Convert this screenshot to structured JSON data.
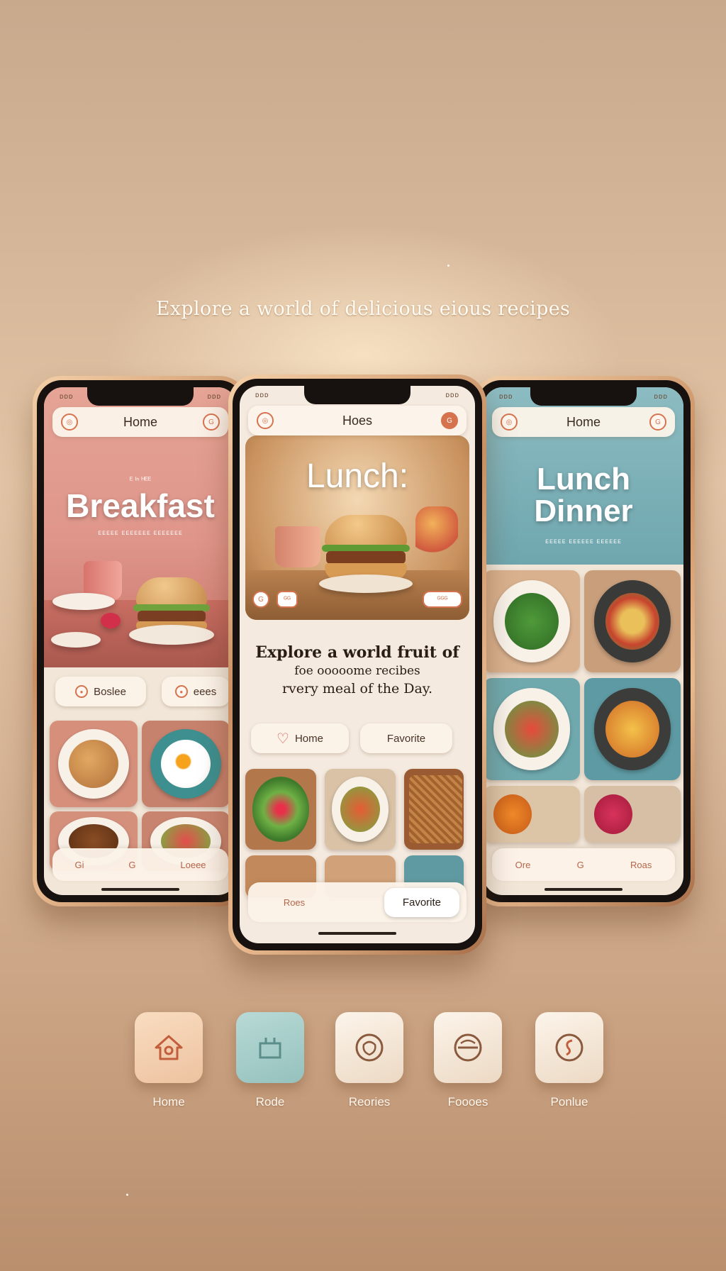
{
  "tagline": "Explore a world of delicious eious recipes",
  "phones": {
    "left": {
      "status_left": "ᴅᴅᴅ",
      "status_right": "ᴅᴅᴅ",
      "header_title": "Home",
      "hero_small": "ᴱ ᴵⁿ ᴴᴱᴱ",
      "hero_title": "Breakfast",
      "hero_sub": "ᴇᴇᴇᴇᴇ ᴇᴇᴇᴇᴇᴇᴇ ᴇᴇᴇᴇᴇᴇᴇ",
      "pill_left": "Boslee",
      "pill_right": "eees",
      "bottom_items": [
        "Gi",
        "G",
        "Loeee"
      ]
    },
    "center": {
      "status_left": "ᴅᴅᴅ",
      "status_right": "ᴅᴅᴅ",
      "header_title": "Hoes",
      "hero_title": "Lunch:",
      "hero_badges": [
        "G",
        "ᴳᴳ",
        "ᴳᴳᴳ"
      ],
      "headline_lines": [
        "Explore a world fruit of",
        "foe ooooome recibes",
        "rvery meal of the Day."
      ],
      "pill_home": "Home",
      "pill_favorite": "Favorite",
      "bottom_left": "Roes",
      "bottom_right": "Favorite"
    },
    "right": {
      "status_left": "ᴅᴅᴅ",
      "status_right": "ᴅᴅᴅ",
      "header_title": "Home",
      "hero_title_1": "Lunch",
      "hero_title_2": "Dinner",
      "hero_sub": "ᴇᴇᴇᴇᴇ ᴇᴇᴇᴇᴇᴇ ᴇᴇᴇᴇᴇᴇ",
      "bottom_items": [
        "Ore",
        "G",
        "Roas"
      ]
    }
  },
  "icon_row": [
    {
      "label": "Home",
      "icon": "home-icon"
    },
    {
      "label": "Rode",
      "icon": "shop-icon"
    },
    {
      "label": "Reories",
      "icon": "recipes-icon"
    },
    {
      "label": "Foooes",
      "icon": "plate-icon"
    },
    {
      "label": "Ponlue",
      "icon": "profile-icon"
    }
  ],
  "colors": {
    "background": "#d8b89a",
    "accent": "#d6734f",
    "breakfast_hero": "#e09a8f",
    "dinner_hero": "#7fb3bb",
    "teal_icon": "#a9cfcb"
  }
}
